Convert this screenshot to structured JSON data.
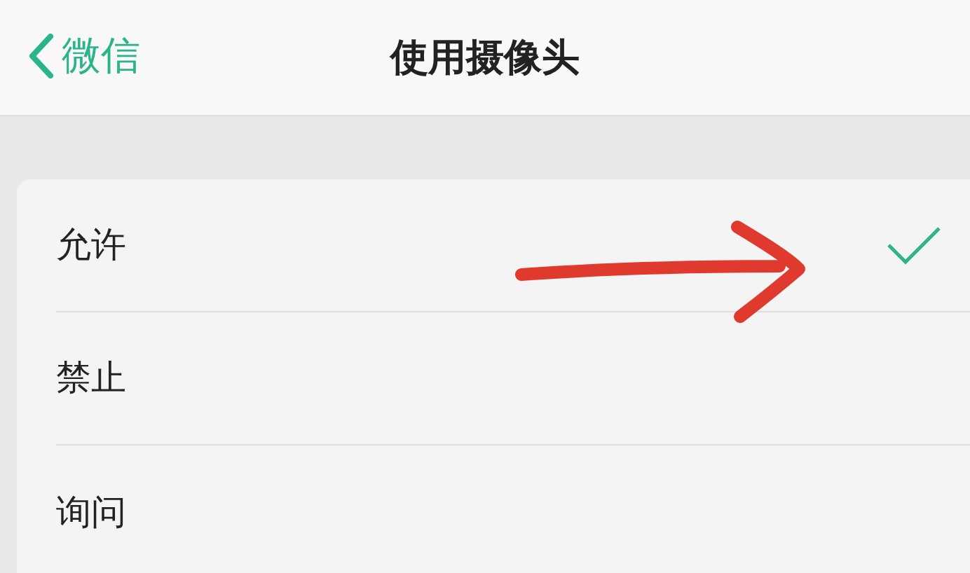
{
  "header": {
    "back_label": "微信",
    "title": "使用摄像头"
  },
  "options": [
    {
      "label": "允许",
      "selected": true
    },
    {
      "label": "禁止",
      "selected": false
    },
    {
      "label": "询问",
      "selected": false
    }
  ]
}
